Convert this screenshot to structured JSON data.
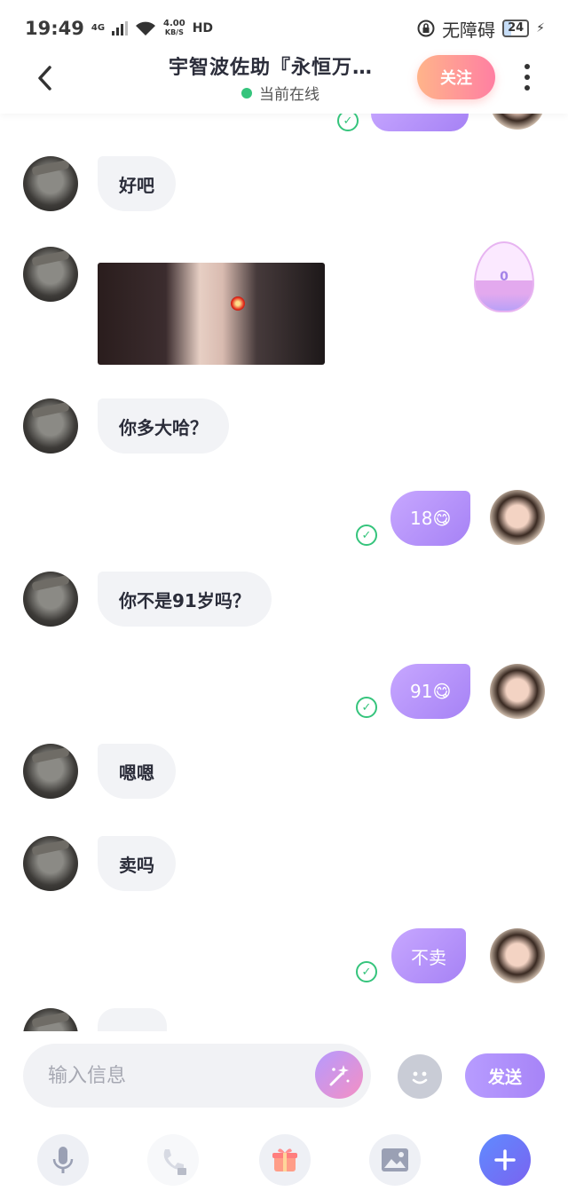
{
  "status_bar": {
    "time": "19:49",
    "network": "4G",
    "speed_value": "4.00",
    "speed_unit": "KB/S",
    "hd": "HD",
    "accessibility": "无障碍",
    "battery": "24"
  },
  "header": {
    "title": "宇智波佐助『永恒万…",
    "status": "当前在线",
    "follow_label": "关注"
  },
  "chat": {
    "flame_count": "0",
    "messages": [
      {
        "side": "in",
        "text": "好吧"
      },
      {
        "side": "in",
        "type": "image"
      },
      {
        "side": "in",
        "text": "你多大哈？"
      },
      {
        "side": "out",
        "text": "18😋"
      },
      {
        "side": "in",
        "text": "你不是91岁吗？"
      },
      {
        "side": "out",
        "text": "91😋"
      },
      {
        "side": "in",
        "text": "嗯嗯"
      },
      {
        "side": "in",
        "text": "卖吗"
      },
      {
        "side": "out",
        "text": "不卖"
      }
    ]
  },
  "input": {
    "placeholder": "输入信息",
    "send_label": "发送"
  },
  "colors": {
    "accent_purple": "#a682f5",
    "follow_gradient_start": "#ffb48a",
    "follow_gradient_end": "#ff7fa2",
    "online_green": "#35c47c"
  },
  "icons": [
    "back-icon",
    "more-icon",
    "check-icon",
    "magic-wand-icon",
    "emoji-icon",
    "microphone-icon",
    "phone-icon",
    "lock-icon",
    "gift-icon",
    "image-icon",
    "plus-icon"
  ]
}
